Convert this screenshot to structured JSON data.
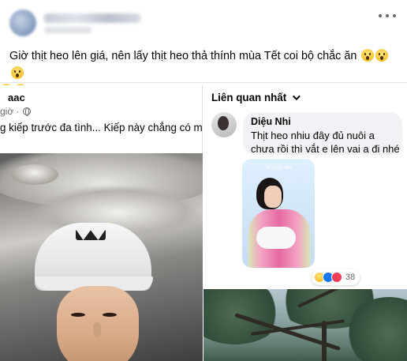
{
  "post": {
    "caption": "Giờ thịt heo lên giá, nên lấy thịt heo thả thính mùa Tết coi bộ chắc ăn",
    "more_label": "More options"
  },
  "shared_post": {
    "author": "aac",
    "time": "giờ ·",
    "text": "g kiếp trước đa tình... Kiếp này chẳng có mối t"
  },
  "comments": {
    "sort_label": "Liên quan nhất",
    "items": [
      {
        "author": "Diệu Nhi",
        "text": "Thịt heo nhiu đây đủ nuôi a chưa rồi thì vắt e lên vai a đi nhé",
        "photo_label": "Bị chụp lén",
        "reaction_count": "38"
      }
    ]
  },
  "icons": {
    "more": "more-horizontal-icon",
    "globe": "globe-icon",
    "chevron": "chevron-down-icon",
    "reactions": [
      "wow-icon",
      "like-icon",
      "love-icon"
    ]
  },
  "colors": {
    "like": "#1877f2",
    "love": "#f33e58",
    "wow": "#f7c531",
    "bubble": "#f0f2f5"
  }
}
